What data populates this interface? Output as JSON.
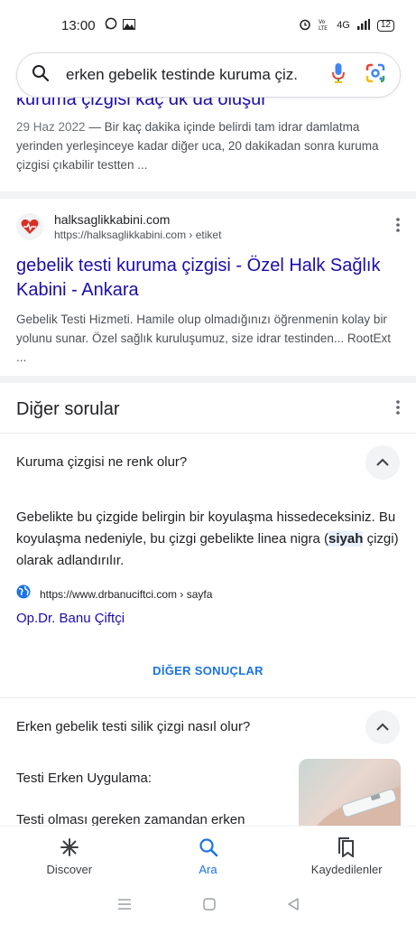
{
  "status_bar": {
    "time": "13:00",
    "network_label": "4G",
    "battery": "12"
  },
  "search": {
    "query": "erken gebelik testinde kuruma çiz..."
  },
  "result1": {
    "title": "kuruma çizgisi kaç dk da oluşur",
    "date": "29 Haz 2022",
    "snippet": " — Bir kaç dakika içinde belirdi tam idrar damlatma yerinden yerleşinceye kadar diğer uca, 20 dakikadan sonra kuruma çizgisi çıkabilir testten ..."
  },
  "result2": {
    "site_name": "halksaglikkabini.com",
    "site_url": "https://halksaglikkabini.com › etiket",
    "title": "gebelik testi kuruma çizgisi - Özel Halk Sağlık Kabini - Ankara",
    "snippet": "Gebelik Testi Hizmeti. Hamile olup olmadığınızı öğrenmenin kolay bir yolunu sunar. Özel sağlık kuruluşumuz, size idrar testinden... RootExt ..."
  },
  "paa": {
    "title": "Diğer sorular",
    "q1": {
      "question": "Kuruma çizgisi ne renk olur?",
      "answer_before": "Gebelikte bu çizgide belirgin bir koyulaşma hissedeceksiniz. Bu koyulaşma nedeniyle, bu çizgi gebelikte linea nigra (",
      "answer_highlight": "siyah",
      "answer_after": " çizgi) olarak adlandırılır.",
      "source_url": "https://www.drbanuciftci.com › sayfa",
      "source_title": "Op.Dr. Banu Çiftçi"
    },
    "more_label": "DİĞER SONUÇLAR",
    "q2": {
      "question": "Erken gebelik testi silik çizgi nasıl olur?",
      "answer_line1": "Testi Erken Uygulama:",
      "answer_line2": "Testi olması gereken zamandan erken"
    }
  },
  "bottom_nav": {
    "discover": "Discover",
    "search": "Ara",
    "saved": "Kaydedilenler"
  },
  "colors": {
    "link": "#1a0dab",
    "accent": "#1a73e8"
  }
}
